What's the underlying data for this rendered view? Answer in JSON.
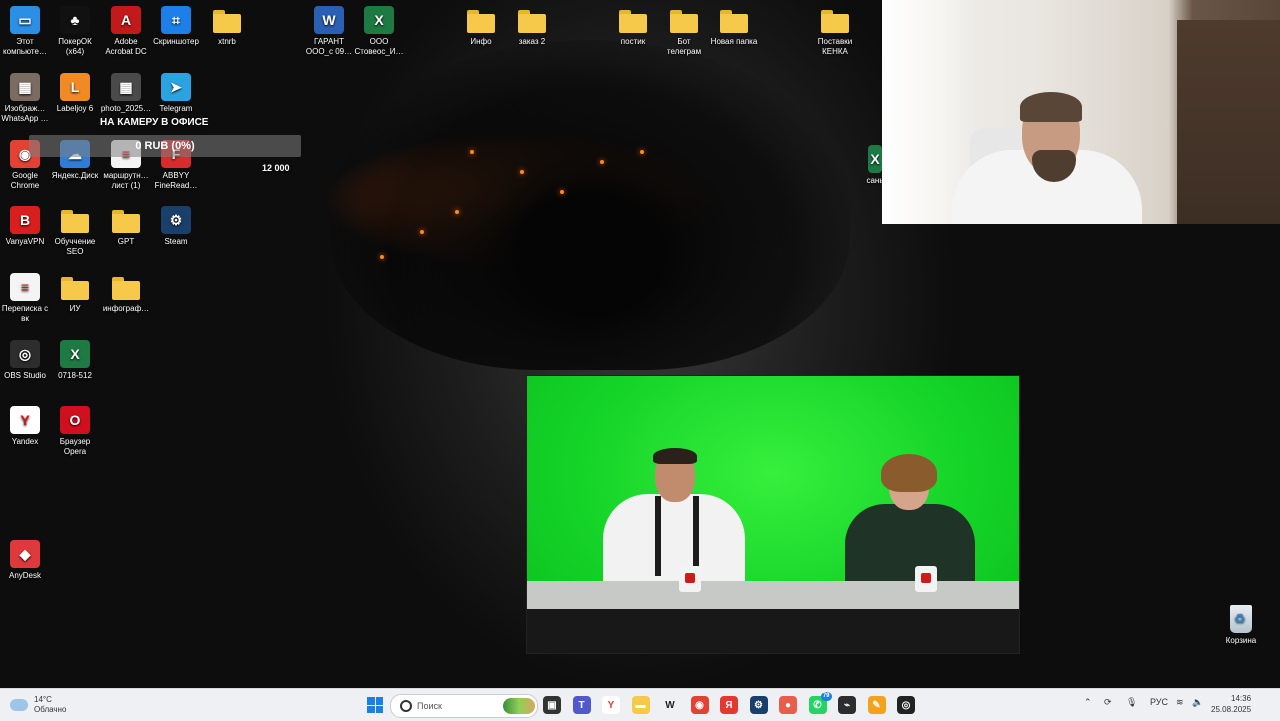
{
  "desktop": {
    "icons": [
      {
        "label": "Этот\nкомпьюте…",
        "icon": "computer-icon",
        "color": "#2b8fe6"
      },
      {
        "label": "ПокерОК\n(x64)",
        "icon": "poker-icon",
        "color": "#111111"
      },
      {
        "label": "Adobe\nAcrobat DC",
        "icon": "acrobat-icon",
        "color": "#c21a1a"
      },
      {
        "label": "Скриншотер",
        "icon": "screenshot-icon",
        "color": "#1d7fe8"
      },
      {
        "label": "xtnrb",
        "icon": "folder-icon",
        "color": "#f6c94a"
      },
      {
        "label": "Изображ…\nWhatsApp …",
        "icon": "image-icon",
        "color": "#7a6c60"
      },
      {
        "label": "Labeljoy 6",
        "icon": "labeljoy-icon",
        "color": "#f08a24"
      },
      {
        "label": "photo_2025…",
        "icon": "photo-icon",
        "color": "#4a4a4a"
      },
      {
        "label": "Telegram",
        "icon": "telegram-icon",
        "color": "#2aa3e0"
      },
      {
        "label": "Google\nChrome",
        "icon": "chrome-icon",
        "color": "#e34133"
      },
      {
        "label": "Яндекс.Диск",
        "icon": "yandex-disk-icon",
        "color": "#2f7dd8"
      },
      {
        "label": "маршрутн…\nлист (1)",
        "icon": "document-icon",
        "color": "#f4f4f4"
      },
      {
        "label": "ABBYY\nFineRead…",
        "icon": "abbyy-icon",
        "color": "#d82b2b"
      },
      {
        "label": "VanyaVPN",
        "icon": "vpn-icon",
        "color": "#d81e1e"
      },
      {
        "label": "Обуччение\nSEO",
        "icon": "folder-icon",
        "color": "#f6c94a"
      },
      {
        "label": "GPT",
        "icon": "folder-icon",
        "color": "#f6c94a"
      },
      {
        "label": "Steam",
        "icon": "steam-icon",
        "color": "#1b3f6b"
      },
      {
        "label": "Переписка с\nвк",
        "icon": "document-icon",
        "color": "#f4f4f4"
      },
      {
        "label": "ИУ",
        "icon": "folder-icon",
        "color": "#f6c94a"
      },
      {
        "label": "инфограф…",
        "icon": "folder-icon",
        "color": "#f6c94a"
      },
      {
        "label": "OBS Studio",
        "icon": "obs-icon",
        "color": "#2d2d2d"
      },
      {
        "label": "0718-512",
        "icon": "excel-icon",
        "color": "#1d7a43"
      },
      {
        "label": "Yandex",
        "icon": "yandex-browser-icon",
        "color": "#ffffff"
      },
      {
        "label": "Браузер\nOpera",
        "icon": "opera-icon",
        "color": "#d0101f"
      },
      {
        "label": "AnyDesk",
        "icon": "anydesk-icon",
        "color": "#e0393b"
      },
      {
        "label": "ГАРАНТ\nООО_с 09…",
        "icon": "word-icon",
        "color": "#2b5fb4"
      },
      {
        "label": "ООО\nСтовеос_И…",
        "icon": "excel-icon",
        "color": "#1d7a43"
      },
      {
        "label": "Инфо",
        "icon": "folder-icon",
        "color": "#f6c94a"
      },
      {
        "label": "заказ 2",
        "icon": "folder-icon",
        "color": "#f6c94a"
      },
      {
        "label": "постик",
        "icon": "folder-icon",
        "color": "#f6c94a"
      },
      {
        "label": "Бот\nтелеграм",
        "icon": "folder-icon",
        "color": "#f6c94a"
      },
      {
        "label": "Новая папка",
        "icon": "folder-icon",
        "color": "#f6c94a"
      },
      {
        "label": "Поставки\nКЕНКА",
        "icon": "folder-icon",
        "color": "#f6c94a"
      }
    ],
    "partial_icon_label": "сань",
    "recycle_bin_label": "Корзина"
  },
  "overlay": {
    "donation_title": "НА КАМЕРУ В ОФИСЕ",
    "progress_text": "0 RUB (0%)",
    "progress_fraction": 0,
    "goal_amount": "12 000"
  },
  "taskbar": {
    "weather_temp": "14°C",
    "weather_desc": "Облачно",
    "search_placeholder": "Поиск",
    "apps": [
      "task-view-icon",
      "teams-icon",
      "yandex-icon",
      "file-explorer-icon",
      "wildberries-icon",
      "chrome-icon",
      "yandex-browser-icon",
      "steam-icon",
      "screen-recorder-icon",
      "whatsapp-icon",
      "network-tool-icon",
      "notes-app-icon",
      "obs-icon"
    ],
    "whatsapp_badge": "79",
    "language": "РУС",
    "time": "14:36",
    "date": "25.08.2025"
  },
  "colors": {
    "taskbar_bg": "#eef0f4",
    "accent": "#1f7fe0",
    "green_screen": "#15d428"
  }
}
